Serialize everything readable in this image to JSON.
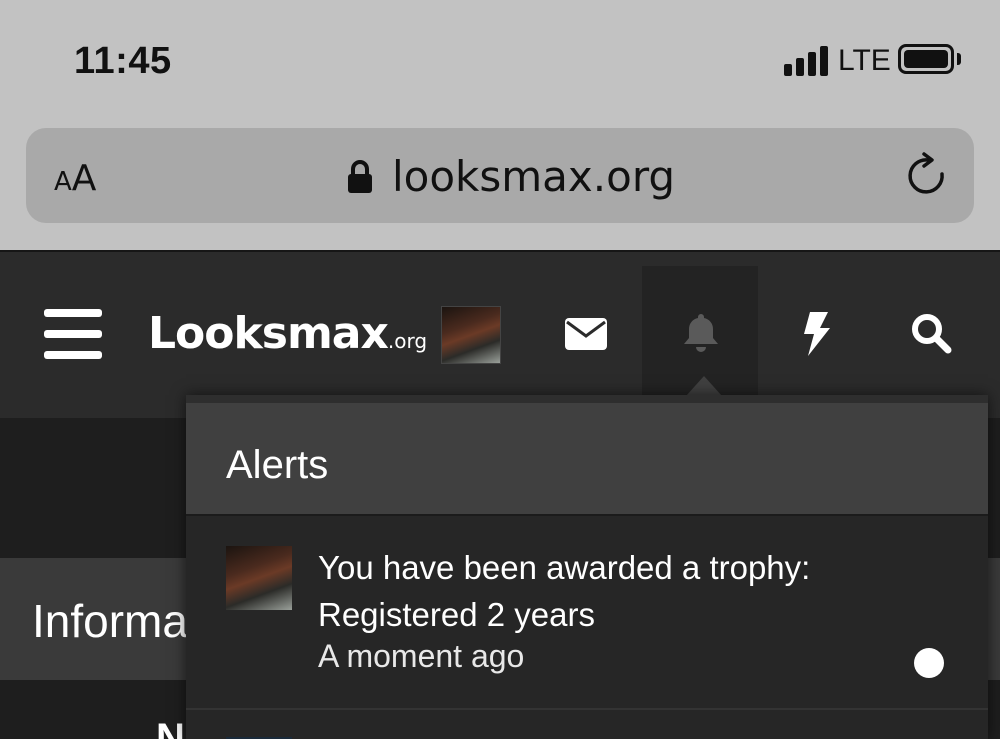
{
  "status_bar": {
    "time": "11:45",
    "network": "LTE"
  },
  "browser": {
    "text_size_button": {
      "small": "A",
      "large": "A"
    },
    "url": "looksmax.org"
  },
  "header": {
    "logo_main": "Looksmax",
    "logo_suffix": ".org",
    "icons": [
      "menu-icon",
      "mail-icon",
      "bell-icon",
      "bolt-icon",
      "search-icon"
    ]
  },
  "page": {
    "section_title": "Informa",
    "partial_text": "N"
  },
  "alerts": {
    "title": "Alerts",
    "items": [
      {
        "text": "You have been awarded a trophy: Registered 2 years",
        "time": "A moment ago",
        "unread": true
      }
    ]
  },
  "colors": {
    "header_bg": "#2b2b2b",
    "dropdown_header_bg": "#404040",
    "dropdown_bg": "#262626",
    "browser_chrome": "#c2c2c2"
  }
}
